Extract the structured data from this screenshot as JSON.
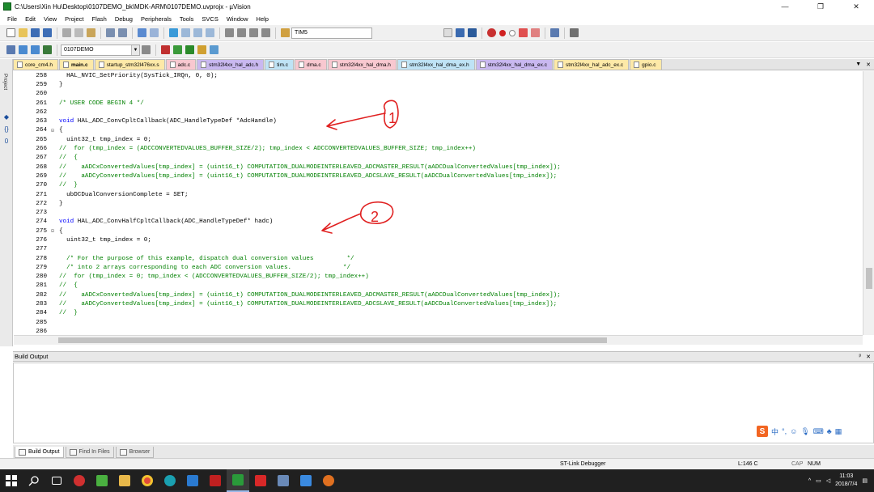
{
  "window": {
    "title": "C:\\Users\\Xin Hu\\Desktop\\0107DEMO_bk\\MDK-ARM\\0107DEMO.uvprojx - µVision",
    "minimize_glyph": "—",
    "restore_glyph": "❐",
    "close_glyph": "✕"
  },
  "menu": [
    "File",
    "Edit",
    "View",
    "Project",
    "Flash",
    "Debug",
    "Peripherals",
    "Tools",
    "SVCS",
    "Window",
    "Help"
  ],
  "toolbar1": {
    "find_value": "TIM5"
  },
  "toolbar2": {
    "target_value": "0107DEMO"
  },
  "sidebar": {
    "label": "Project"
  },
  "file_tabs": [
    {
      "label": "core_cm4.h",
      "color": "#fde9a8",
      "active": false
    },
    {
      "label": "main.c",
      "color": "#fde9a8",
      "active": true
    },
    {
      "label": "startup_stm32l476xx.s",
      "color": "#fde9a8",
      "active": false
    },
    {
      "label": "adc.c",
      "color": "#f8c8d0",
      "active": false
    },
    {
      "label": "stm32l4xx_hal_adc.h",
      "color": "#c9b8f0",
      "active": false
    },
    {
      "label": "tim.c",
      "color": "#bfe3f5",
      "active": false
    },
    {
      "label": "dma.c",
      "color": "#f8c8d0",
      "active": false
    },
    {
      "label": "stm32l4xx_hal_dma.h",
      "color": "#f8c8d0",
      "active": false
    },
    {
      "label": "stm32l4xx_hal_dma_ex.h",
      "color": "#bfe3f5",
      "active": false
    },
    {
      "label": "stm32l4xx_hal_dma_ex.c",
      "color": "#c9b8f0",
      "active": false
    },
    {
      "label": "stm32l4xx_hal_adc_ex.c",
      "color": "#fde9a8",
      "active": false
    },
    {
      "label": "gpio.c",
      "color": "#fde9a8",
      "active": false
    }
  ],
  "code": [
    {
      "line": "258",
      "fold": "",
      "text": "  HAL_NVIC_SetPriority(SysTick_IRQn, 0, 0);",
      "style": "normal"
    },
    {
      "line": "259",
      "fold": "",
      "text": "}",
      "style": "normal"
    },
    {
      "line": "260",
      "fold": "",
      "text": "",
      "style": "normal"
    },
    {
      "line": "261",
      "fold": "",
      "text": "/* USER CODE BEGIN 4 */",
      "style": "comment"
    },
    {
      "line": "262",
      "fold": "",
      "text": "",
      "style": "normal"
    },
    {
      "line": "263",
      "fold": "",
      "text": "void HAL_ADC_ConvCpltCallback(ADC_HandleTypeDef *AdcHandle)",
      "style": "normal"
    },
    {
      "line": "264",
      "fold": "⊟",
      "text": "{",
      "style": "normal"
    },
    {
      "line": "265",
      "fold": "",
      "text": "  uint32_t tmp_index = 0;",
      "style": "normal"
    },
    {
      "line": "266",
      "fold": "",
      "text": "//  for (tmp_index = (ADCCONVERTEDVALUES_BUFFER_SIZE/2); tmp_index < ADCCONVERTEDVALUES_BUFFER_SIZE; tmp_index++)",
      "style": "comment"
    },
    {
      "line": "267",
      "fold": "",
      "text": "//  {",
      "style": "comment"
    },
    {
      "line": "268",
      "fold": "",
      "text": "//    aADCxConvertedValues[tmp_index] = (uint16_t) COMPUTATION_DUALMODEINTERLEAVED_ADCMASTER_RESULT(aADCDualConvertedValues[tmp_index]);",
      "style": "comment"
    },
    {
      "line": "269",
      "fold": "",
      "text": "//    aADCyConvertedValues[tmp_index] = (uint16_t) COMPUTATION_DUALMODEINTERLEAVED_ADCSLAVE_RESULT(aADCDualConvertedValues[tmp_index]);",
      "style": "comment"
    },
    {
      "line": "270",
      "fold": "",
      "text": "//  }",
      "style": "comment"
    },
    {
      "line": "271",
      "fold": "",
      "text": "  ubDCDualConversionComplete = SET;",
      "style": "normal"
    },
    {
      "line": "272",
      "fold": "",
      "text": "}",
      "style": "normal"
    },
    {
      "line": "273",
      "fold": "",
      "text": "",
      "style": "normal"
    },
    {
      "line": "274",
      "fold": "",
      "text": "void HAL_ADC_ConvHalfCpltCallback(ADC_HandleTypeDef* hadc)",
      "style": "normal"
    },
    {
      "line": "275",
      "fold": "⊟",
      "text": "{",
      "style": "normal"
    },
    {
      "line": "276",
      "fold": "",
      "text": "  uint32_t tmp_index = 0;",
      "style": "normal"
    },
    {
      "line": "277",
      "fold": "",
      "text": "",
      "style": "normal"
    },
    {
      "line": "278",
      "fold": "",
      "text": "  /* For the purpose of this example, dispatch dual conversion values         */",
      "style": "comment"
    },
    {
      "line": "279",
      "fold": "",
      "text": "  /* into 2 arrays corresponding to each ADC conversion values.              */",
      "style": "comment"
    },
    {
      "line": "280",
      "fold": "",
      "text": "//  for (tmp_index = 0; tmp_index < (ADCCONVERTEDVALUES_BUFFER_SIZE/2); tmp_index++)",
      "style": "comment"
    },
    {
      "line": "281",
      "fold": "",
      "text": "//  {",
      "style": "comment"
    },
    {
      "line": "282",
      "fold": "",
      "text": "//    aADCxConvertedValues[tmp_index] = (uint16_t) COMPUTATION_DUALMODEINTERLEAVED_ADCMASTER_RESULT(aADCDualConvertedValues[tmp_index]);",
      "style": "comment"
    },
    {
      "line": "283",
      "fold": "",
      "text": "//    aADCyConvertedValues[tmp_index] = (uint16_t) COMPUTATION_DUALMODEINTERLEAVED_ADCSLAVE_RESULT(aADCDualConvertedValues[tmp_index]);",
      "style": "comment"
    },
    {
      "line": "284",
      "fold": "",
      "text": "//  }",
      "style": "comment"
    },
    {
      "line": "285",
      "fold": "",
      "text": "",
      "style": "normal"
    },
    {
      "line": "286",
      "fold": "",
      "text": "",
      "style": "normal"
    }
  ],
  "build_output": {
    "title": "Build Output",
    "pin_glyph": "ᵖ",
    "close_glyph": "✕"
  },
  "bottom_tabs": [
    {
      "label": "Build Output",
      "active": true
    },
    {
      "label": "Find In Files",
      "active": false
    },
    {
      "label": "Browser",
      "active": false
    }
  ],
  "status": {
    "debugger": "ST-Link Debugger",
    "position": "L:146 C",
    "cap": "CAP",
    "num": "NUM"
  },
  "tray": {
    "ime_mode": "中",
    "time": "11:03",
    "date": "2018/7/4"
  },
  "annotations": [
    "1",
    "2"
  ],
  "colors": {
    "comment": "#008000",
    "keyword": "#0000ff",
    "annotation": "#e02020",
    "taskbar": "#202020"
  }
}
